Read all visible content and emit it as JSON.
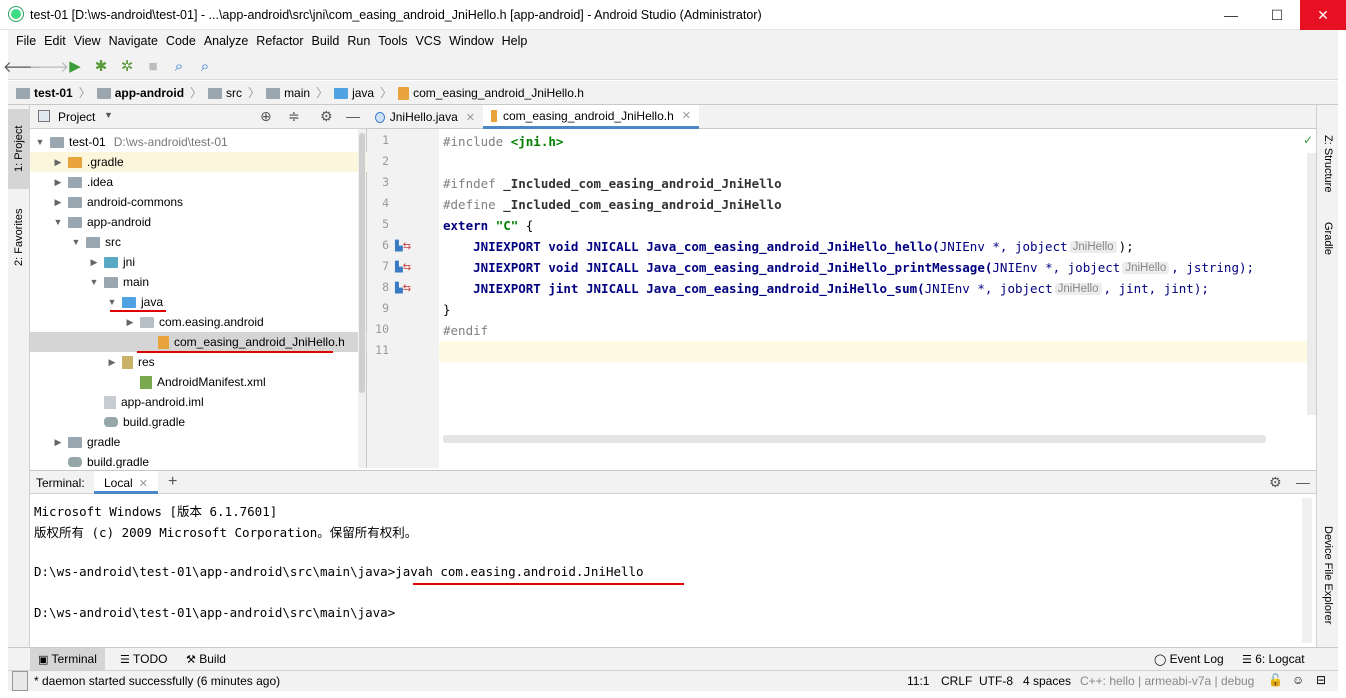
{
  "window": {
    "title": "test-01 [D:\\ws-android\\test-01] - ...\\app-android\\src\\jni\\com_easing_android_JniHello.h [app-android] - Android Studio (Administrator)",
    "min_label": "—",
    "max_label": "☐",
    "close_label": "✕"
  },
  "menu": [
    "File",
    "Edit",
    "View",
    "Navigate",
    "Code",
    "Analyze",
    "Refactor",
    "Build",
    "Run",
    "Tools",
    "VCS",
    "Window",
    "Help"
  ],
  "breadcrumb": [
    {
      "label": "test-01",
      "bold": true
    },
    {
      "label": "app-android",
      "bold": true
    },
    {
      "label": "src"
    },
    {
      "label": "main"
    },
    {
      "label": "java"
    },
    {
      "label": "com_easing_android_JniHello.h"
    }
  ],
  "left_strip": {
    "project": "1: Project",
    "favorites": "2: Favorites"
  },
  "right_strip": {
    "structure": "Z: Structure",
    "gradle": "Gradle",
    "device": "Device File Explorer"
  },
  "project_panel": {
    "title": "Project",
    "tree": [
      {
        "label": "test-01",
        "extra": "D:\\ws-android\\test-01",
        "indent": 0,
        "arrow": "▼",
        "icon": "module"
      },
      {
        "label": ".gradle",
        "indent": 1,
        "arrow": "▶",
        "icon": "folder-orange",
        "highlight": true
      },
      {
        "label": ".idea",
        "indent": 1,
        "arrow": "▶",
        "icon": "folder"
      },
      {
        "label": "android-commons",
        "indent": 1,
        "arrow": "▶",
        "icon": "module"
      },
      {
        "label": "app-android",
        "indent": 1,
        "arrow": "▼",
        "icon": "module"
      },
      {
        "label": "src",
        "indent": 2,
        "arrow": "▼",
        "icon": "folder"
      },
      {
        "label": "jni",
        "indent": 3,
        "arrow": "▶",
        "icon": "folder-teal"
      },
      {
        "label": "main",
        "indent": 3,
        "arrow": "▼",
        "icon": "folder"
      },
      {
        "label": "java",
        "indent": 4,
        "arrow": "▼",
        "icon": "folder-blue"
      },
      {
        "label": "com.easing.android",
        "indent": 5,
        "arrow": "▶",
        "icon": "package"
      },
      {
        "label": "com_easing_android_JniHello.h",
        "indent": 6,
        "arrow": "",
        "icon": "h-file",
        "selected": true
      },
      {
        "label": "res",
        "indent": 4,
        "arrow": "▶",
        "icon": "res"
      },
      {
        "label": "AndroidManifest.xml",
        "indent": 5,
        "arrow": "",
        "icon": "manifest"
      },
      {
        "label": "app-android.iml",
        "indent": 3,
        "arrow": "",
        "icon": "iml"
      },
      {
        "label": "build.gradle",
        "indent": 3,
        "arrow": "",
        "icon": "gradle"
      },
      {
        "label": "gradle",
        "indent": 1,
        "arrow": "▶",
        "icon": "folder"
      },
      {
        "label": "build.gradle",
        "indent": 1,
        "arrow": "",
        "icon": "gradle"
      }
    ]
  },
  "editor": {
    "tabs": [
      {
        "label": "JniHello.java",
        "active": false
      },
      {
        "label": "com_easing_android_JniHello.h",
        "active": true
      }
    ],
    "line_numbers": [
      "1",
      "2",
      "3",
      "4",
      "5",
      "6",
      "7",
      "8",
      "9",
      "10",
      "11"
    ],
    "lines": {
      "l1_pp": "#include ",
      "l1_str": "<jni.h>",
      "l3_pp": "#ifndef ",
      "l3_b": "_Included_com_easing_android_JniHello",
      "l4_pp": "#define ",
      "l4_b": "_Included_com_easing_android_JniHello",
      "l5_kw": "extern ",
      "l5_str": "\"C\"",
      "l5_rest": " {",
      "l6_a": "    JNIEXPORT ",
      "l6_kw": "void",
      "l6_b": " JNICALL Java_com_easing_android_JniHello_hello(",
      "l6_ty": "JNIEnv *, jobject",
      "l6_hint": "JniHello",
      "l6_end": ");",
      "l7_a": "    JNIEXPORT ",
      "l7_kw": "void",
      "l7_b": " JNICALL Java_com_easing_android_JniHello_printMessage(",
      "l7_ty": "JNIEnv *, jobject",
      "l7_hint": "JniHello",
      "l7_end": ", jstring);",
      "l8_a": "    JNIEXPORT ",
      "l8_kw": "jint",
      "l8_b": " JNICALL Java_com_easing_android_JniHello_sum(",
      "l8_ty": "JNIEnv *, jobject",
      "l8_hint": "JniHello",
      "l8_end": ", jint, jint);",
      "l9": "}",
      "l10": "#endif"
    }
  },
  "terminal": {
    "label": "Terminal:",
    "tab": "Local",
    "lines": [
      "Microsoft Windows [版本 6.1.7601]",
      "版权所有 (c) 2009 Microsoft Corporation。保留所有权利。",
      "",
      "D:\\ws-android\\test-01\\app-android\\src\\main\\java>javah com.easing.android.JniHello",
      "",
      "D:\\ws-android\\test-01\\app-android\\src\\main\\java>"
    ]
  },
  "bottom_tabs": {
    "terminal": "Terminal",
    "todo": "TODO",
    "build": "Build",
    "event_log": "Event Log",
    "logcat": "6: Logcat"
  },
  "status": {
    "message": "* daemon started successfully (6 minutes ago)",
    "position": "11:1",
    "line_sep": "CRLF",
    "encoding": "UTF-8",
    "indent": "4 spaces",
    "context": "C++: hello | armeabi-v7a | debug"
  },
  "colors": {
    "annotation_red": "#e00000",
    "selection": "#d5d5d5",
    "caret_line": "#fffae3"
  }
}
